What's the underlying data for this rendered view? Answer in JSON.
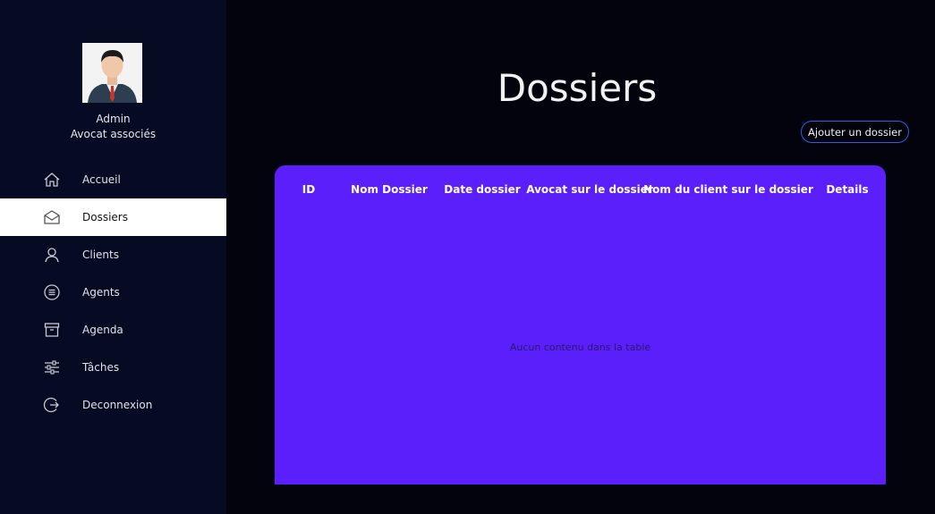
{
  "user": {
    "name": "Admin",
    "role": "Avocat associés"
  },
  "nav": {
    "items": [
      {
        "label": "Accueil",
        "icon": "home-icon"
      },
      {
        "label": "Dossiers",
        "icon": "mail-open-icon"
      },
      {
        "label": "Clients",
        "icon": "user-icon"
      },
      {
        "label": "Agents",
        "icon": "list-circle-icon"
      },
      {
        "label": "Agenda",
        "icon": "archive-icon"
      },
      {
        "label": "Tâches",
        "icon": "sliders-icon"
      },
      {
        "label": "Deconnexion",
        "icon": "logout-icon"
      }
    ],
    "active": "Dossiers"
  },
  "main": {
    "title": "Dossiers",
    "add_button": "Ajouter un dossier"
  },
  "table": {
    "columns": [
      "ID",
      "Nom Dossier",
      "Date dossier",
      "Avocat sur le dossier",
      "Nom du client sur le dossier",
      "Details"
    ],
    "rows": [],
    "empty_text": "Aucun contenu dans la table"
  },
  "colors": {
    "sidebar_bg": "#060a22",
    "page_bg": "#03030d",
    "table_bg": "#5b1ffc",
    "button_border": "#2f5fe6"
  }
}
